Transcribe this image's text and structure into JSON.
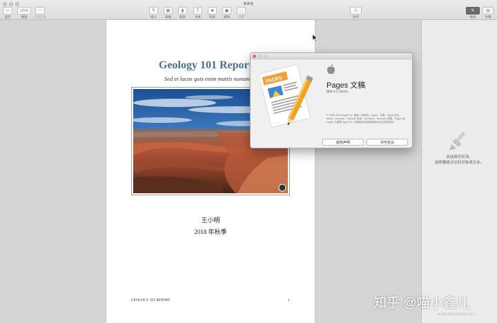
{
  "window": {
    "title": "未命名"
  },
  "toolbar": {
    "view_label": "显示",
    "zoom_value": "125%",
    "zoom_label": "缩放",
    "add_page_label": "添加页面",
    "insert_label": "插入",
    "table_label": "表格",
    "chart_label": "图表",
    "text_label": "文本",
    "shape_label": "形状",
    "media_label": "媒体",
    "comment_label": "注释",
    "collaborate_label": "协作",
    "format_label": "格式",
    "document_label": "文稿"
  },
  "document": {
    "title": "Geology 101 Report",
    "subtitle": "Sed et lacus quis enim mattis nonummy",
    "author": "王小明",
    "term": "2018 年秋季",
    "footer_title": "GEOLOGY 101 REPORT",
    "footer_page": "1"
  },
  "inspector": {
    "empty_line1": "未选择任何项。",
    "empty_line2": "选择要格式化的对象或文本。"
  },
  "about": {
    "app_name": "Pages 文稿",
    "version": "版本 8.2 (6520)",
    "copyright": "© 2005–2018 Apple Inc. 保留一切权利。Apple、苹果、Apple 标志、iWork、Keynote、Keynote 讲演、Numbers、Numbers 表格、Pages 和 Pages 文稿是 Apple Inc. 在美国及其他国家和地区注册的商标。",
    "app_icon_text": "PAGES",
    "license_button": "版权声明",
    "agreement_button": "许可协议"
  },
  "watermark": {
    "zhihu": "知乎 @喵小鑫儿",
    "site": "www.MacDown.com"
  },
  "colors": {
    "title_blue": "#4a6e94",
    "pages_orange": "#f0a13b",
    "close_red": "#fc605b"
  }
}
